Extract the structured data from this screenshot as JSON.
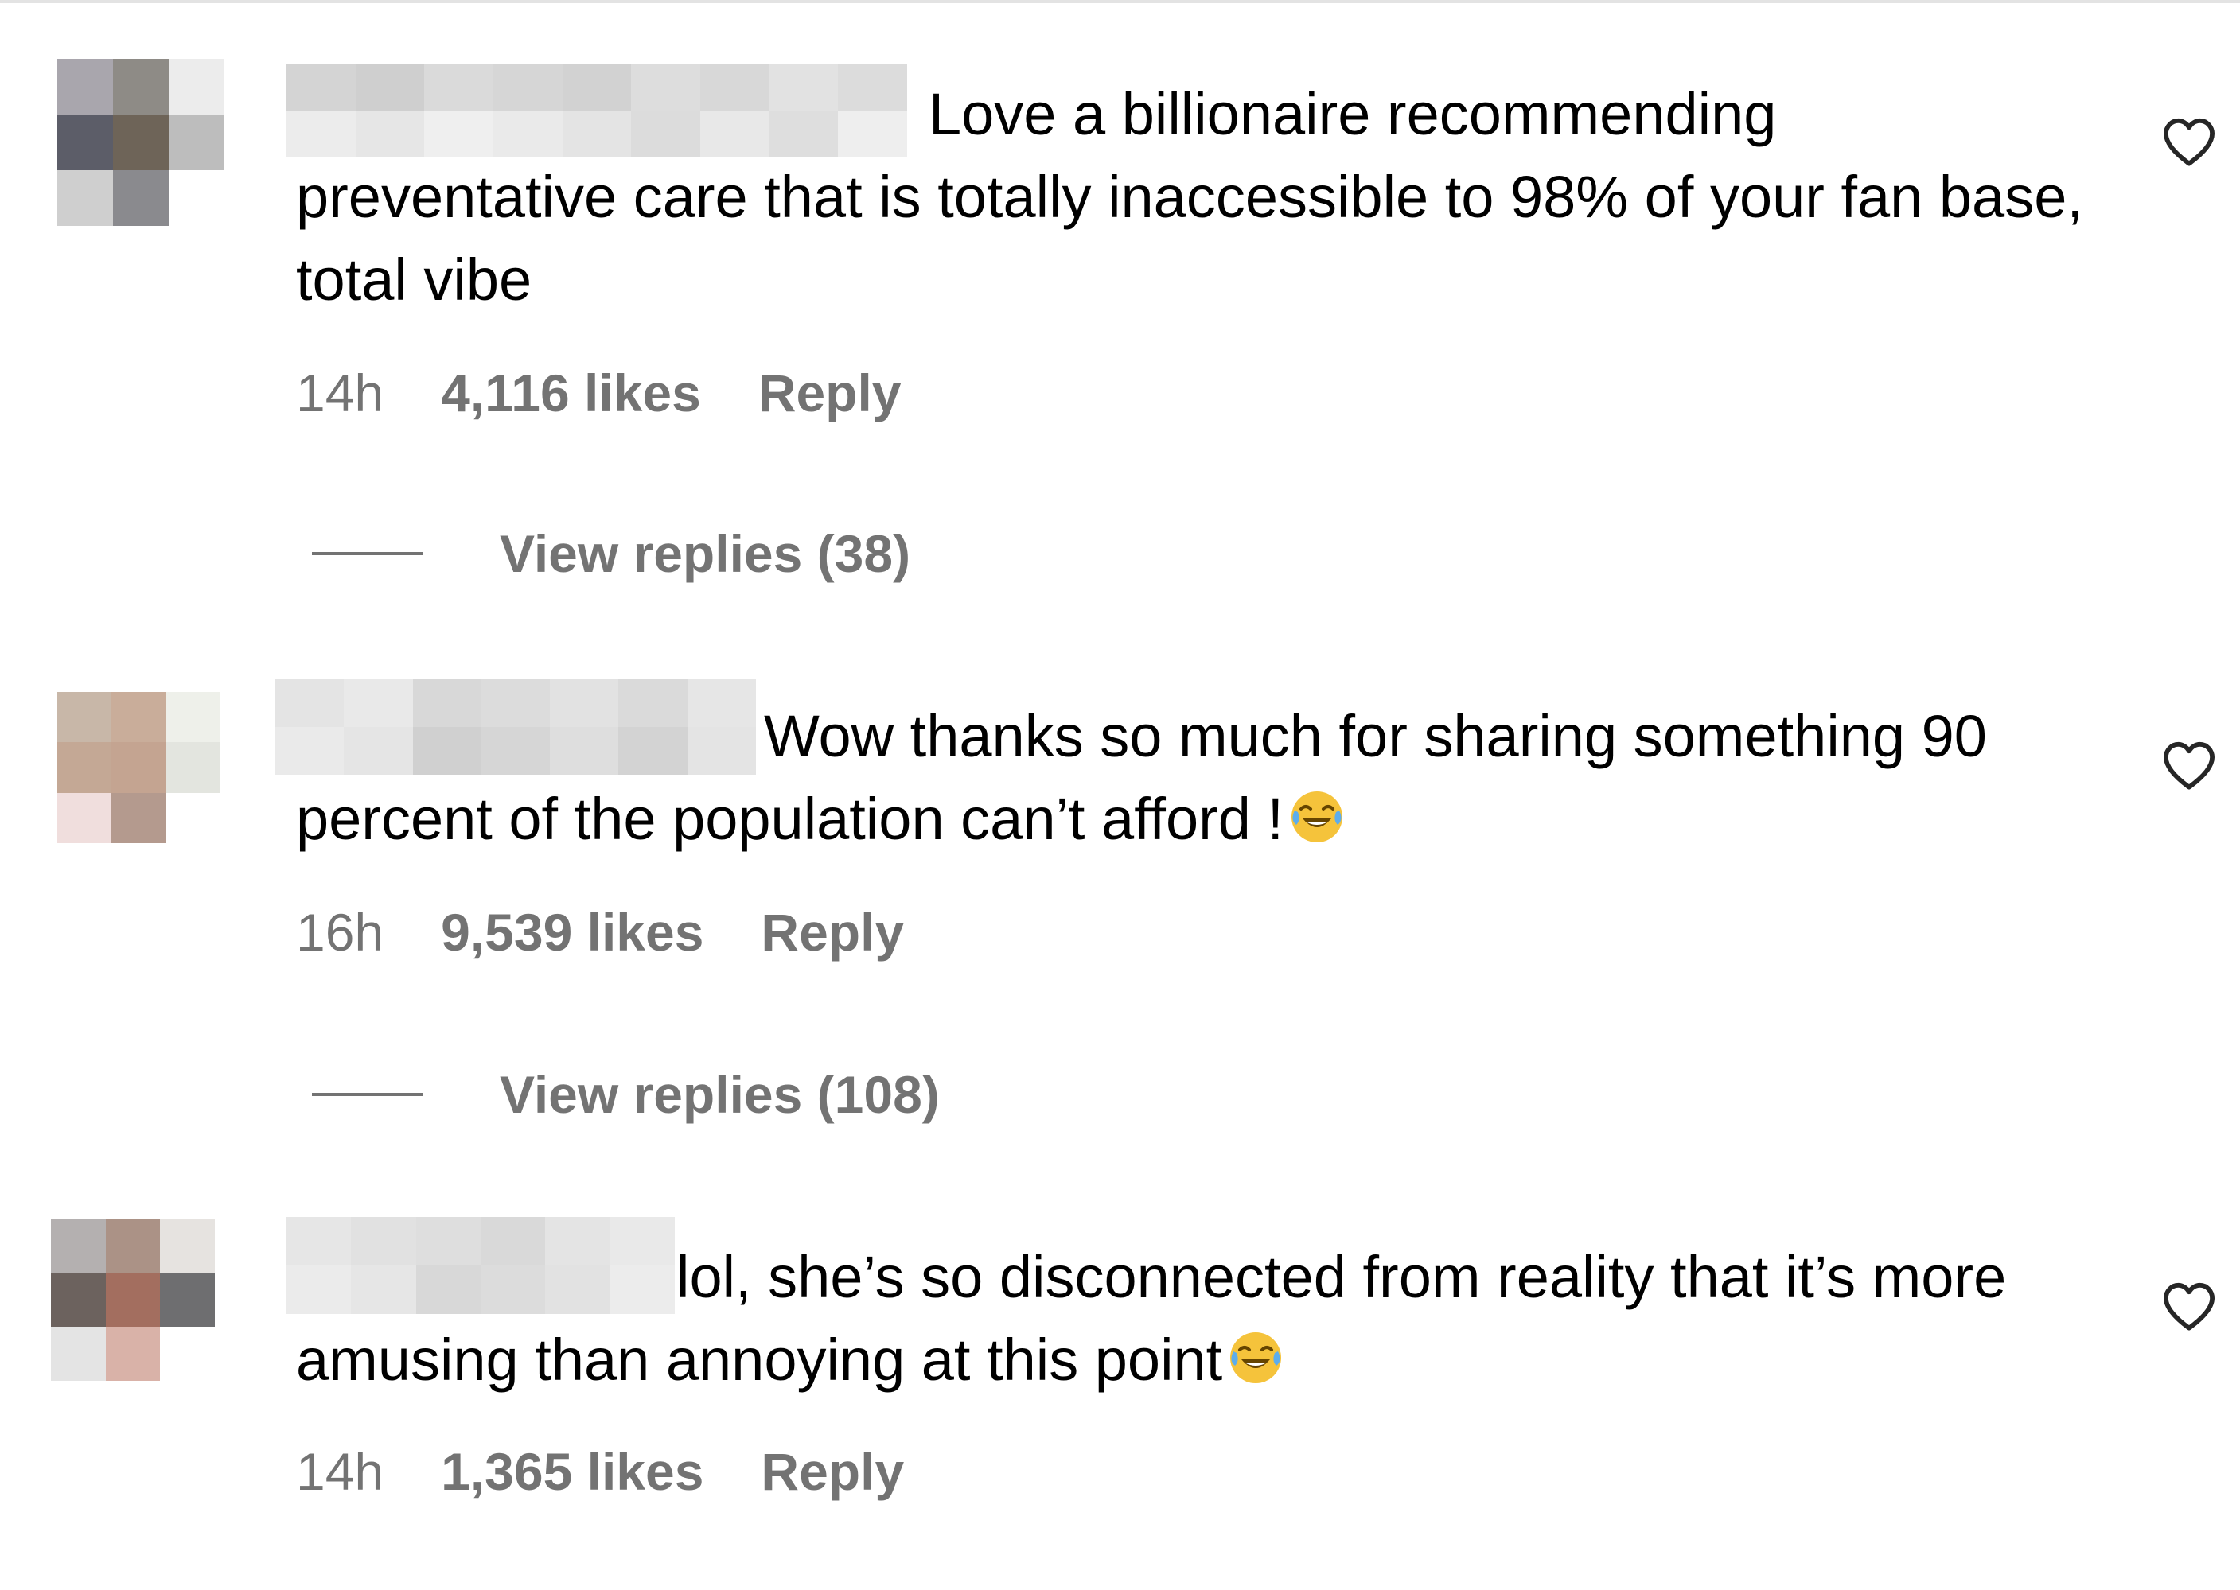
{
  "comments": [
    {
      "text": "Love a billionaire recommending preventative care that is totally inaccessible to 98% of your fan base, total vibe",
      "time": "14h",
      "likes": "4,116 likes",
      "reply_label": "Reply",
      "view_replies": "View replies (38)",
      "emoji": "",
      "avatar_colors": [
        "#a9a6ad",
        "#8e8b86",
        "#ececec",
        "#5c5d68",
        "#6e6458",
        "#bdbdbd",
        "#cfcfcf",
        "#8a8a8e",
        "#ffffff"
      ]
    },
    {
      "text": "Wow thanks so much for sharing something 90 percent of the population can’t afford !",
      "time": "16h",
      "likes": "9,539 likes",
      "reply_label": "Reply",
      "view_replies": "View replies (108)",
      "emoji": "face-with-tears-of-joy",
      "avatar_colors": [
        "#c8b7a8",
        "#c9ad9a",
        "#eef0ea",
        "#c4a895",
        "#c4a491",
        "#e3e5df",
        "#f0dedd",
        "#b49a8e",
        "#ffffff"
      ]
    },
    {
      "text": "lol, she’s so disconnected from reality that it’s more amusing than annoying at this point",
      "time": "14h",
      "likes": "1,365 likes",
      "reply_label": "Reply",
      "view_replies": "",
      "emoji": "face-with-tears-of-joy",
      "avatar_colors": [
        "#b4b0b0",
        "#ab9286",
        "#e6e3e0",
        "#6c625e",
        "#a36e5f",
        "#6e6e70",
        "#e4e4e4",
        "#d9b2a8",
        "#ffffff"
      ]
    }
  ],
  "colors": {
    "text": "#000000",
    "secondary": "#737373",
    "divider": "#e3e3e3"
  }
}
